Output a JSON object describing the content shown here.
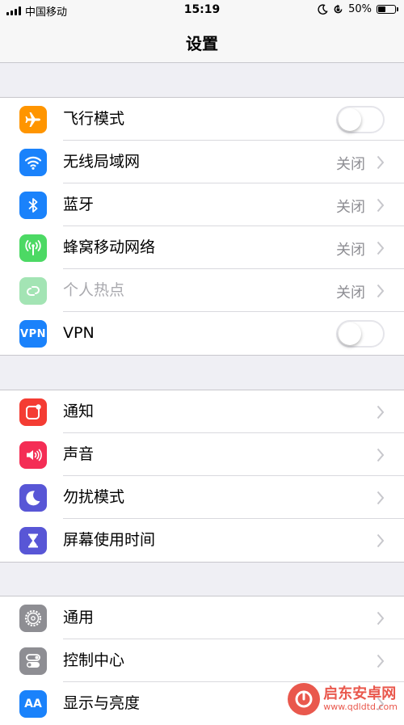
{
  "status_bar": {
    "carrier": "中国移动",
    "time": "15:19",
    "battery_percent": "50%",
    "battery_level": 0.5,
    "icons": [
      "signal-bars-icon",
      "moon-icon",
      "rotation-lock-icon",
      "battery-icon"
    ]
  },
  "nav": {
    "title": "设置"
  },
  "groups": [
    {
      "rows": [
        {
          "label": "飞行模式",
          "icon": "airplane-icon",
          "icon_color": "#ff9500",
          "control": "toggle",
          "toggle_on": false
        },
        {
          "label": "无线局域网",
          "icon": "wifi-icon",
          "icon_color": "#1a82fb",
          "value": "关闭",
          "control": "chevron"
        },
        {
          "label": "蓝牙",
          "icon": "bluetooth-icon",
          "icon_color": "#1a82fb",
          "value": "关闭",
          "control": "chevron"
        },
        {
          "label": "蜂窝移动网络",
          "icon": "cellular-icon",
          "icon_color": "#4cd964",
          "value": "关闭",
          "control": "chevron"
        },
        {
          "label": "个人热点",
          "icon": "hotspot-icon",
          "icon_color": "#a3e4b4",
          "value": "关闭",
          "control": "chevron",
          "disabled": true
        },
        {
          "label": "VPN",
          "icon": "vpn-icon",
          "icon_text": "VPN",
          "icon_color": "#1a82fb",
          "control": "toggle",
          "toggle_on": false
        }
      ]
    },
    {
      "rows": [
        {
          "label": "通知",
          "icon": "notifications-icon",
          "icon_color": "#f43c33",
          "control": "chevron"
        },
        {
          "label": "声音",
          "icon": "sound-icon",
          "icon_color": "#f42d55",
          "control": "chevron"
        },
        {
          "label": "勿扰模式",
          "icon": "moon-icon",
          "icon_color": "#5856d6",
          "control": "chevron"
        },
        {
          "label": "屏幕使用时间",
          "icon": "hourglass-icon",
          "icon_color": "#5856d6",
          "control": "chevron"
        }
      ]
    },
    {
      "rows": [
        {
          "label": "通用",
          "icon": "gear-icon",
          "icon_color": "#8e8e93",
          "control": "chevron"
        },
        {
          "label": "控制中心",
          "icon": "control-center-icon",
          "icon_color": "#8e8e93",
          "control": "chevron"
        },
        {
          "label": "显示与亮度",
          "icon": "display-brightness-icon",
          "icon_text": "AA",
          "icon_color": "#1a82fb",
          "control": "chevron"
        }
      ]
    }
  ],
  "watermark": {
    "name": "启东安卓网",
    "url": "www.qdldtd.com",
    "icon": "watermark-logo-icon",
    "color": "#e63b2e"
  }
}
